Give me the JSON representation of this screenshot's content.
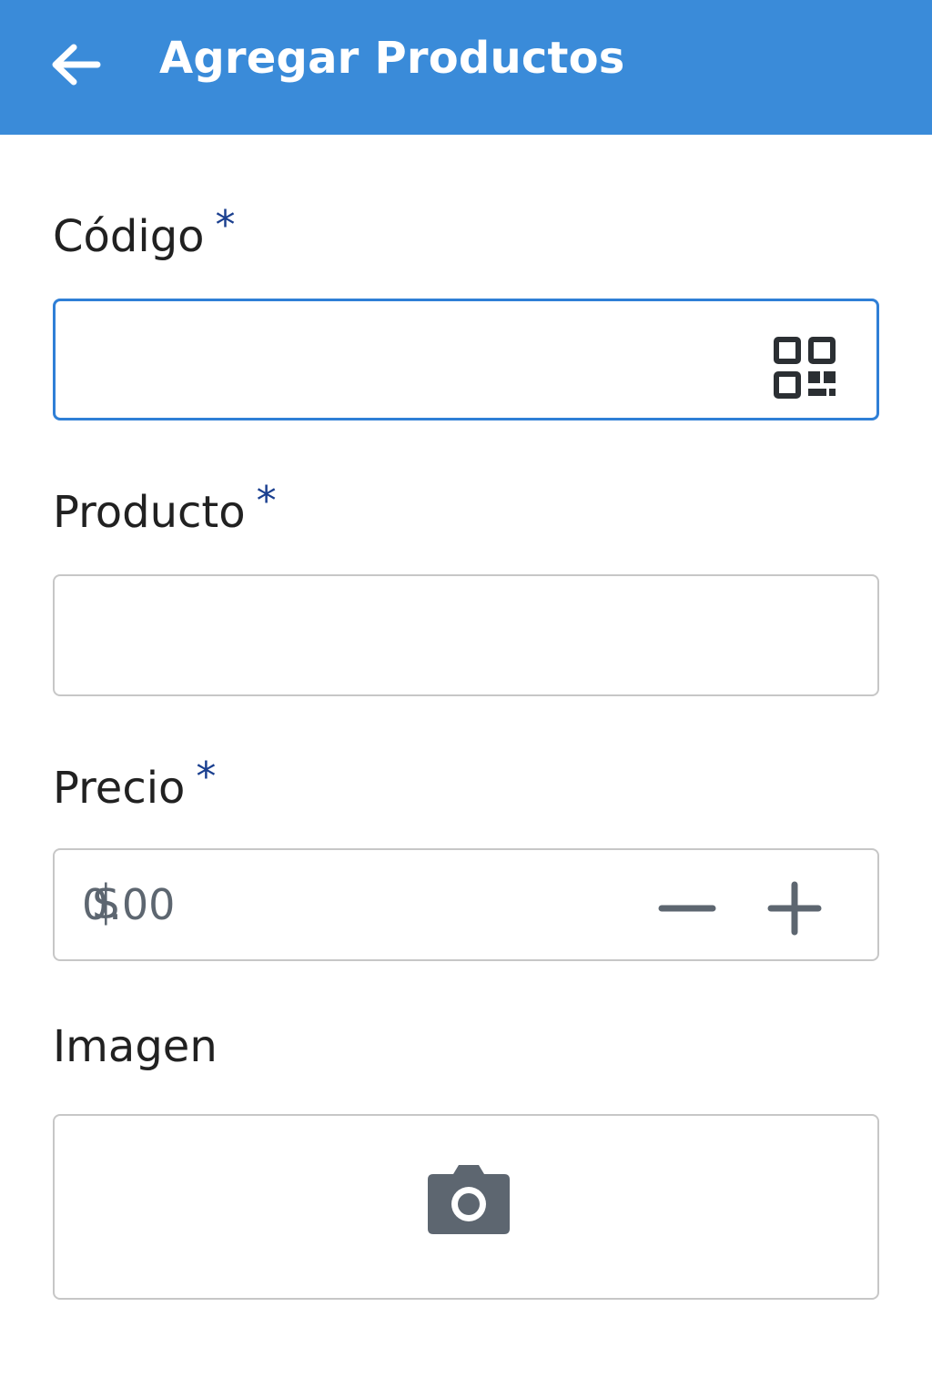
{
  "appbar": {
    "title": "Agregar Productos",
    "back_icon": "arrow-left-icon",
    "background": "#3a8bd9"
  },
  "form": {
    "codigo": {
      "label": "Código",
      "required_mark": "*",
      "value": "",
      "action_icon": "qr-code-icon"
    },
    "producto": {
      "label": "Producto",
      "required_mark": "*",
      "value": ""
    },
    "precio": {
      "label": "Precio",
      "required_mark": "*",
      "currency_symbol": "$",
      "placeholder": "0.00",
      "decrement_icon": "minus-icon",
      "increment_icon": "plus-icon"
    },
    "imagen": {
      "label": "Imagen",
      "action_icon": "camera-icon"
    }
  },
  "colors": {
    "accent": "#2f7fd6",
    "required_mark": "#1a3f8f",
    "icon_gray": "#5d6670"
  }
}
